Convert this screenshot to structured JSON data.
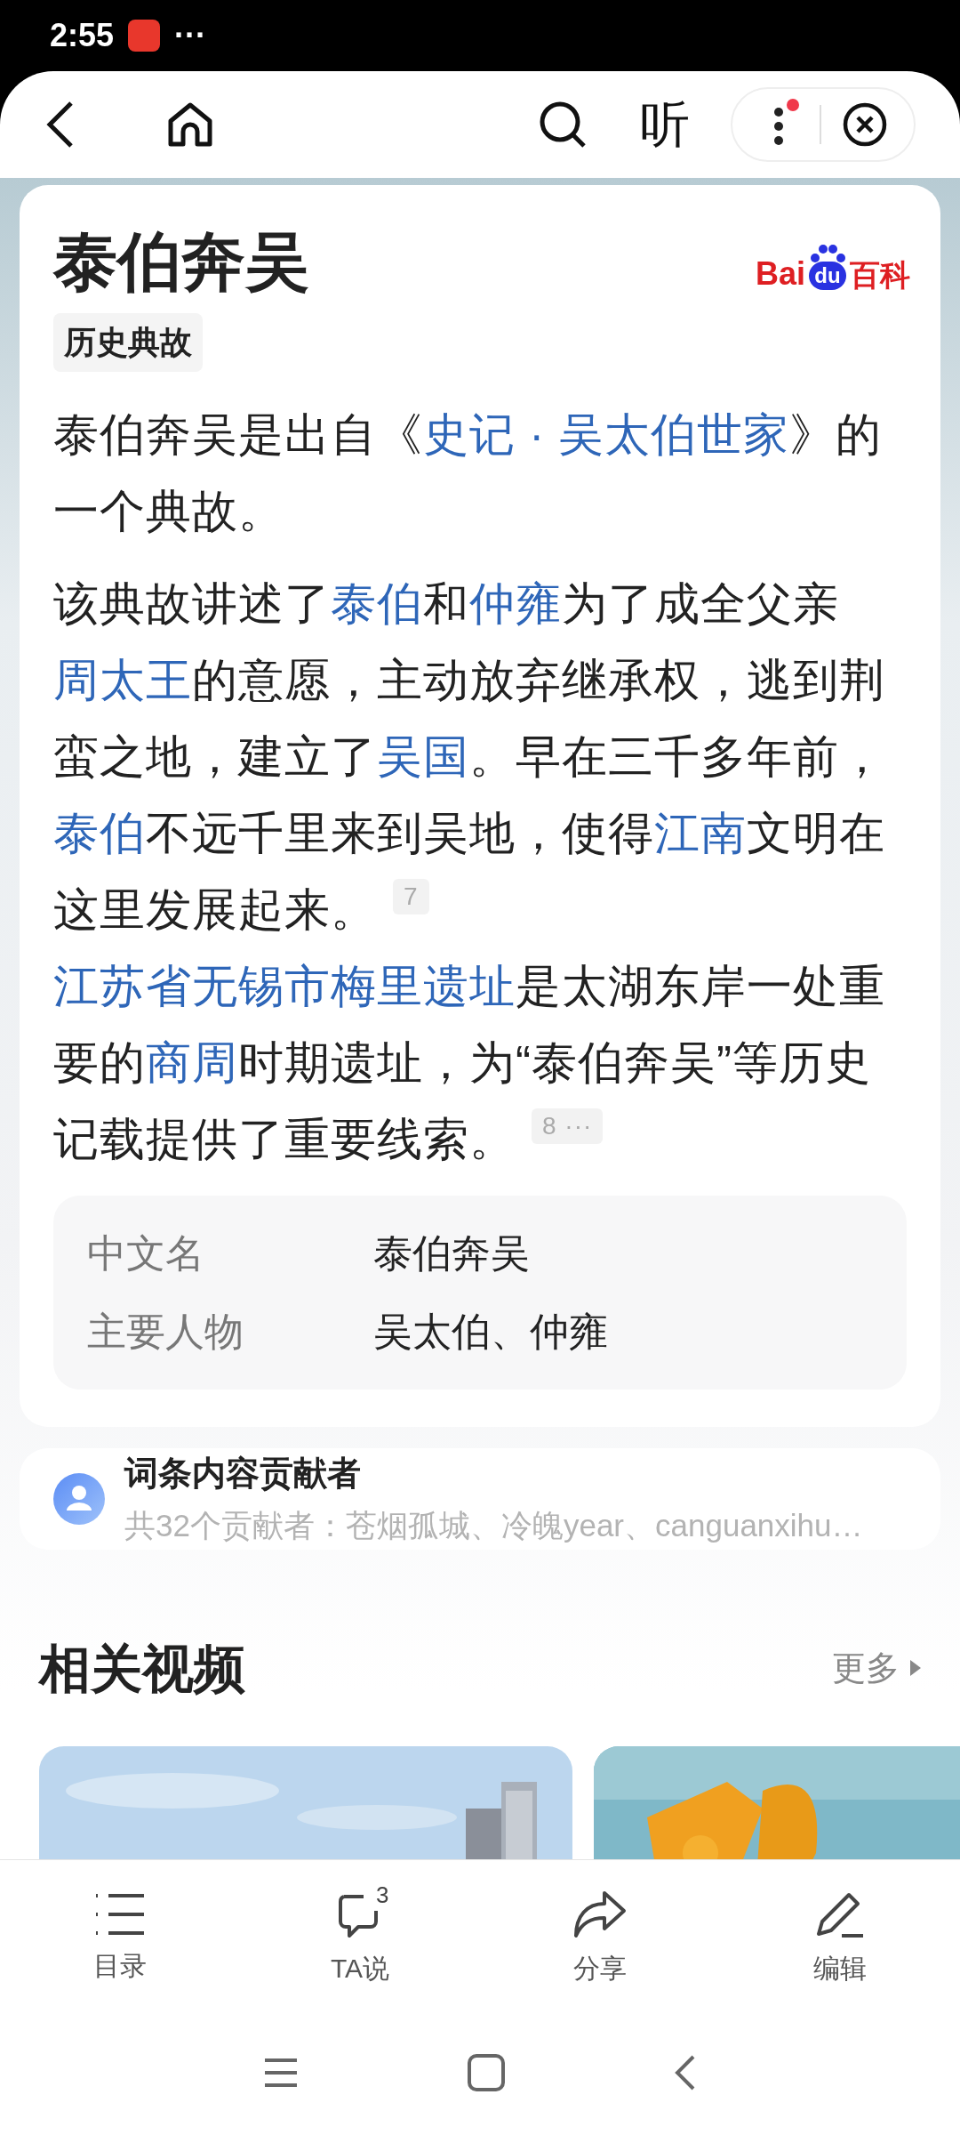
{
  "status_bar": {
    "time": "2:55",
    "overflow": "···"
  },
  "top_bar": {
    "listen": "听"
  },
  "entry": {
    "title": "泰伯奔吴",
    "category": "历史典故",
    "logo": {
      "part_1": "Bai",
      "part_2": "du",
      "part_3": "百科"
    },
    "paragraphs": [
      [
        {
          "kind": "text",
          "text": "泰伯奔吴是出自《"
        },
        {
          "kind": "link",
          "text": "史记 · 吴太伯世家"
        },
        {
          "kind": "text",
          "text": "》的一个典故。"
        }
      ],
      [
        {
          "kind": "text",
          "text": "该典故讲述了"
        },
        {
          "kind": "link",
          "text": "泰伯"
        },
        {
          "kind": "text",
          "text": "和"
        },
        {
          "kind": "link",
          "text": "仲雍"
        },
        {
          "kind": "text",
          "text": "为了成全父亲"
        },
        {
          "kind": "link",
          "text": "周太王"
        },
        {
          "kind": "text",
          "text": "的意愿，主动放弃继承权，逃到荆蛮之地，建立了"
        },
        {
          "kind": "link",
          "text": "吴国"
        },
        {
          "kind": "text",
          "text": "。早在三千多年前，"
        },
        {
          "kind": "link",
          "text": "泰伯"
        },
        {
          "kind": "text",
          "text": "不远千里来到吴地，使得"
        },
        {
          "kind": "link",
          "text": "江南"
        },
        {
          "kind": "text",
          "text": "文明在这里发展起来。"
        },
        {
          "kind": "ref",
          "text": "7"
        },
        {
          "kind": "link",
          "text": "江苏省无锡市梅里遗址"
        },
        {
          "kind": "text",
          "text": "是太湖东岸一处重要的"
        },
        {
          "kind": "link",
          "text": "商周"
        },
        {
          "kind": "text",
          "text": "时期遗址，为“泰伯奔吴”等历史记载提供了重要线索。"
        },
        {
          "kind": "ref",
          "text": "8 ···"
        }
      ]
    ],
    "infobox": [
      {
        "label": "中文名",
        "value": "泰伯奔吴"
      },
      {
        "label": "主要人物",
        "value": "吴太伯、仲雍"
      }
    ]
  },
  "contributors": {
    "title": "词条内容贡献者",
    "summary": "共32个贡献者：苍烟孤城、冷魄year、canguanxihu…"
  },
  "related_videos": {
    "title": "相关视频",
    "more": "更多"
  },
  "toolbar": [
    {
      "label": "目录"
    },
    {
      "label": "TA说",
      "badge": "3"
    },
    {
      "label": "分享"
    },
    {
      "label": "编辑"
    }
  ]
}
